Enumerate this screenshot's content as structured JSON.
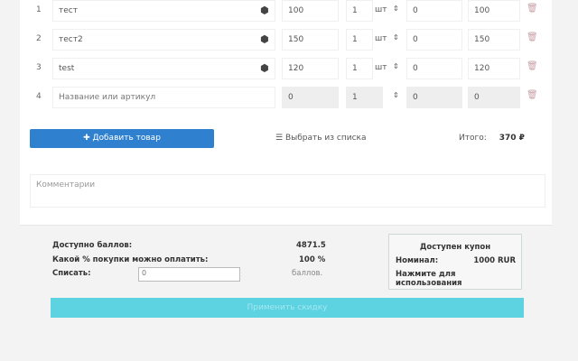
{
  "items": [
    {
      "n": "1",
      "name": "тест",
      "price": "100",
      "qty": "1",
      "unit": "шт",
      "discount": "0",
      "sum": "100"
    },
    {
      "n": "2",
      "name": "тест2",
      "price": "150",
      "qty": "1",
      "unit": "шт",
      "discount": "0",
      "sum": "150"
    },
    {
      "n": "3",
      "name": "test",
      "price": "120",
      "qty": "1",
      "unit": "шт",
      "discount": "0",
      "sum": "120"
    }
  ],
  "new_item": {
    "n": "4",
    "name_placeholder": "Название или артикул",
    "price": "0",
    "qty": "1",
    "discount": "0",
    "sum": "0"
  },
  "add_button": "Добавить товар",
  "pick_from_list": "Выбрать из списка",
  "total_label": "Итого:",
  "total_value": "370 ₽",
  "comment_placeholder": "Комментарии",
  "points": {
    "available_label": "Доступно баллов:",
    "available_value": "4871.5",
    "percent_label": "Какой % покупки можно оплатить:",
    "percent_value": "100 %",
    "write_off_label": "Списать:",
    "write_off_value": "0",
    "unit": "баллов."
  },
  "coupon": {
    "title": "Доступен купон",
    "nominal_label": "Номинал:",
    "nominal_value": "1000 RUR",
    "hint": "Нажмите для использования"
  },
  "apply_button": "Применить скидку"
}
